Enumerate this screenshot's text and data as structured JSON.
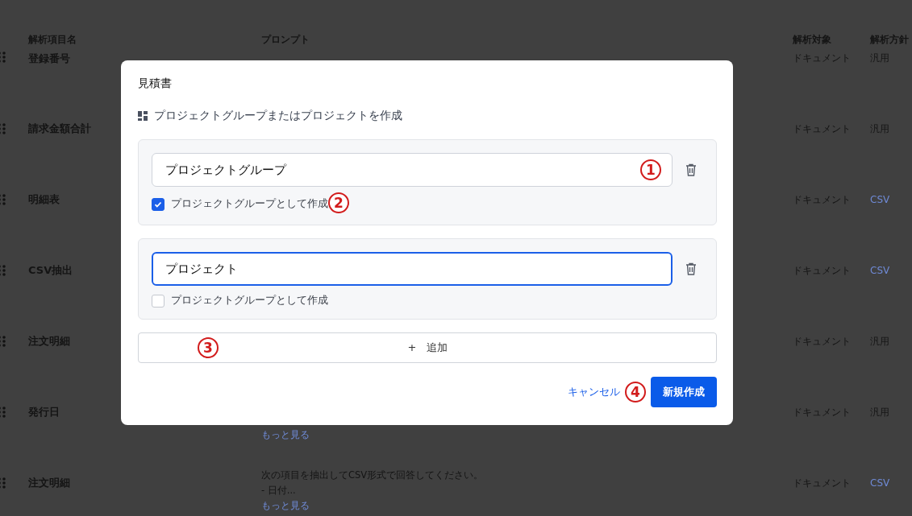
{
  "table": {
    "columns": [
      "解析項目名",
      "プロンプト",
      "解析対象",
      "解析方針"
    ],
    "rows": [
      {
        "name": "登録番号",
        "prompt": [],
        "target": "ドキュメント",
        "policy": "汎用",
        "policy_link": false
      },
      {
        "name": "請求金額合計",
        "prompt": [],
        "target": "ドキュメント",
        "policy": "汎用",
        "policy_link": false
      },
      {
        "name": "明細表",
        "prompt": [],
        "target": "ドキュメント",
        "policy": "CSV",
        "policy_link": true
      },
      {
        "name": "CSV抽出",
        "prompt": [],
        "target": "ドキュメント",
        "policy": "CSV",
        "policy_link": true
      },
      {
        "name": "注文明細",
        "prompt": [],
        "target": "ドキュメント",
        "policy": "汎用",
        "policy_link": false
      },
      {
        "name": "発行日",
        "prompt": [
          {
            "kind": "link",
            "text": "もっと見る"
          }
        ],
        "target": "ドキュメント",
        "policy": "汎用",
        "policy_link": false
      },
      {
        "name": "注文明細",
        "prompt": [
          {
            "kind": "text",
            "text": "次の項目を抽出してCSV形式で回答してください。"
          },
          {
            "kind": "text",
            "text": "- 日付..."
          },
          {
            "kind": "link",
            "text": "もっと見る"
          }
        ],
        "target": "ドキュメント",
        "policy": "CSV",
        "policy_link": true
      }
    ]
  },
  "modal": {
    "title": "見積書",
    "subtitle": "プロジェクトグループまたはプロジェクトを作成",
    "groups": [
      {
        "value": "プロジェクトグループ",
        "focused": false,
        "input_marker": "1",
        "checkbox_label": "プロジェクトグループとして作成",
        "checked": true,
        "checkbox_marker": "2"
      },
      {
        "value": "プロジェクト",
        "focused": true,
        "checkbox_label": "プロジェクトグループとして作成",
        "checked": false
      }
    ],
    "add_button": {
      "icon": "+",
      "label": "追加",
      "marker": "3"
    },
    "cancel": "キャンセル",
    "submit_marker": "4",
    "submit": "新規作成"
  }
}
